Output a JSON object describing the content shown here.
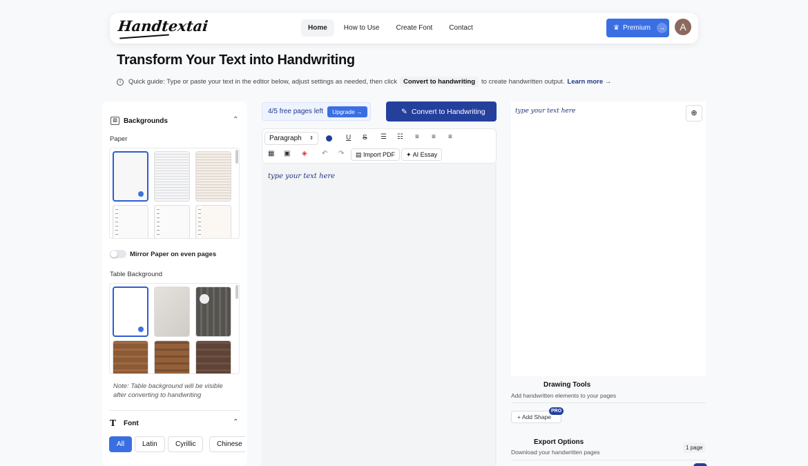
{
  "nav": {
    "logo": "Handtextai",
    "links": [
      "Home",
      "How to Use",
      "Create Font",
      "Contact"
    ],
    "premium": "Premium",
    "premium_arrow": "→",
    "avatar_initial": "A"
  },
  "header": {
    "title": "Transform Your Text into Handwriting",
    "guide_pre": "Quick guide: Type or paste your text in the editor below, adjust settings as needed, then click",
    "guide_chip": "Convert to handwriting",
    "guide_post": "to create handwritten output.",
    "learn_more": "Learn more →"
  },
  "sidebar": {
    "backgrounds_title": "Backgrounds",
    "paper_label": "Paper",
    "mirror_label": "Mirror Paper on even pages",
    "table_label": "Table Background",
    "note": "Note: Table background will be visible after converting to handwriting",
    "font_title": "Font",
    "font_filters": [
      "All",
      "Latin",
      "Cyrillic",
      "Chinese"
    ]
  },
  "editor": {
    "free_pages": "4/5 free pages left",
    "upgrade": "Upgrade →",
    "convert": "Convert to Handwriting",
    "paragraph": "Paragraph",
    "import_pdf": "Import PDF",
    "ai_essay": "AI Essay",
    "text_color": "#1f3c99",
    "placeholder": "type your text here"
  },
  "preview": {
    "placeholder": "type your text here",
    "drawing_title": "Drawing Tools",
    "drawing_sub": "Add handwritten elements to your pages",
    "add_shape": "Add Shape",
    "pro": "PRO",
    "export_title": "Export Options",
    "export_sub": "Download your handwritten pages",
    "page_count": "1 page"
  }
}
